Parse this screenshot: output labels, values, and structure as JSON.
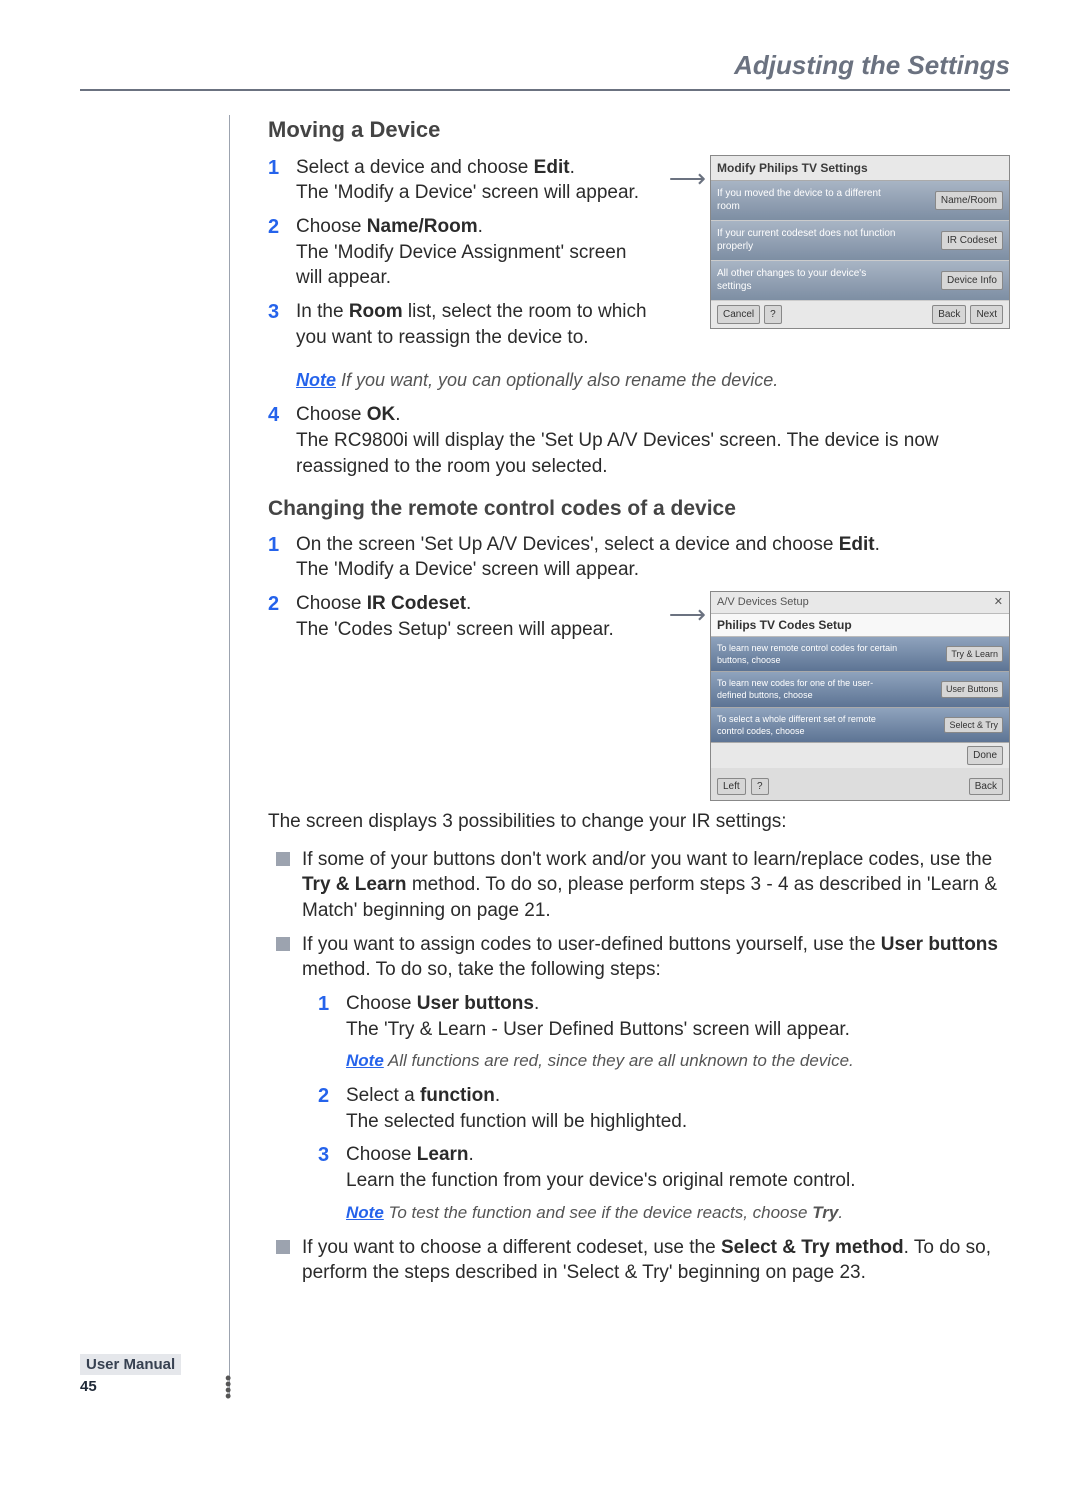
{
  "header": "Adjusting the Settings",
  "side": {
    "manual": "User Manual",
    "page": "45"
  },
  "moving": {
    "title": "Moving a Device",
    "s1a": "Select a device and choose ",
    "s1b": "Edit",
    "s1c": ".",
    "s1d": "The 'Modify a Device' screen will appear.",
    "s2a": "Choose ",
    "s2b": "Name/Room",
    "s2c": ".",
    "s2d": "The 'Modify Device Assignment' screen will appear.",
    "s3a": "In the ",
    "s3b": "Room",
    "s3c": " list, select the room to which you want to reassign the device to.",
    "note1_label": "Note",
    "note1": " If you want, you can optionally also rename the device.",
    "s4a": "Choose ",
    "s4b": "OK",
    "s4c": ".",
    "s4d": "The RC9800i will display the 'Set Up A/V Devices' screen. The device is now reassigned to the room you selected."
  },
  "ss1": {
    "title": "Modify Philips TV Settings",
    "r1t": "If you moved the device to a different room",
    "r1b": "Name/Room",
    "r2t": "If your current codeset does not function properly",
    "r2b": "IR Codeset",
    "r3t": "All other changes to your device's settings",
    "r3b": "Device Info",
    "f_cancel": "Cancel",
    "f_back": "Back",
    "f_next": "Next"
  },
  "changing": {
    "title": "Changing the remote control codes of a device",
    "s1a": "On the screen 'Set Up A/V Devices', select a device and choose ",
    "s1b": "Edit",
    "s1c": ".",
    "s1d": "The 'Modify a Device' screen will appear.",
    "s2a": "Choose ",
    "s2b": "IR Codeset",
    "s2c": ".",
    "s2d": "The 'Codes Setup' screen will appear."
  },
  "ss2": {
    "top": "A/V Devices Setup",
    "sub": "Philips TV Codes Setup",
    "r1t": "To learn new remote control codes for certain buttons, choose",
    "r1b": "Try & Learn",
    "r2t": "To learn new codes for one of the user-defined buttons, choose",
    "r2b": "User Buttons",
    "r3t": "To select a whole different set of remote control codes, choose",
    "r3b": "Select & Try",
    "done": "Done",
    "f_left": "Left",
    "f_back": "Back"
  },
  "tail": {
    "intro": "The screen displays 3 possibilities to change your IR settings:",
    "b1a": "If some of your buttons don't work and/or you want to learn/replace codes, use the ",
    "b1b": "Try & Learn",
    "b1c": " method. To do so, please perform steps 3 - 4 as described in 'Learn & Match' beginning on page 21.",
    "b2a": "If you want to assign codes to user-defined buttons yourself, use the ",
    "b2b": "User buttons",
    "b2c": " method. To do so, take the following steps:",
    "i1a": "Choose ",
    "i1b": "User buttons",
    "i1c": ".",
    "i1d": "The 'Try & Learn - User Defined Buttons' screen will appear.",
    "i1_note": " All functions are red, since they are all unknown to the device.",
    "i2a": "Select a ",
    "i2b": "function",
    "i2c": ".",
    "i2d": "The selected function will be highlighted.",
    "i3a": "Choose ",
    "i3b": "Learn",
    "i3c": ".",
    "i3d": "Learn the function from your device's original remote control.",
    "i3_note_a": " To test the function and see if the device reacts, choose ",
    "i3_note_b": "Try",
    "i3_note_c": ".",
    "b3a": "If you want to choose a different codeset, use the ",
    "b3b": "Select & Try method",
    "b3c": ". To do so, perform the steps described in 'Select & Try' beginning on page 23."
  },
  "note_label": "Note"
}
